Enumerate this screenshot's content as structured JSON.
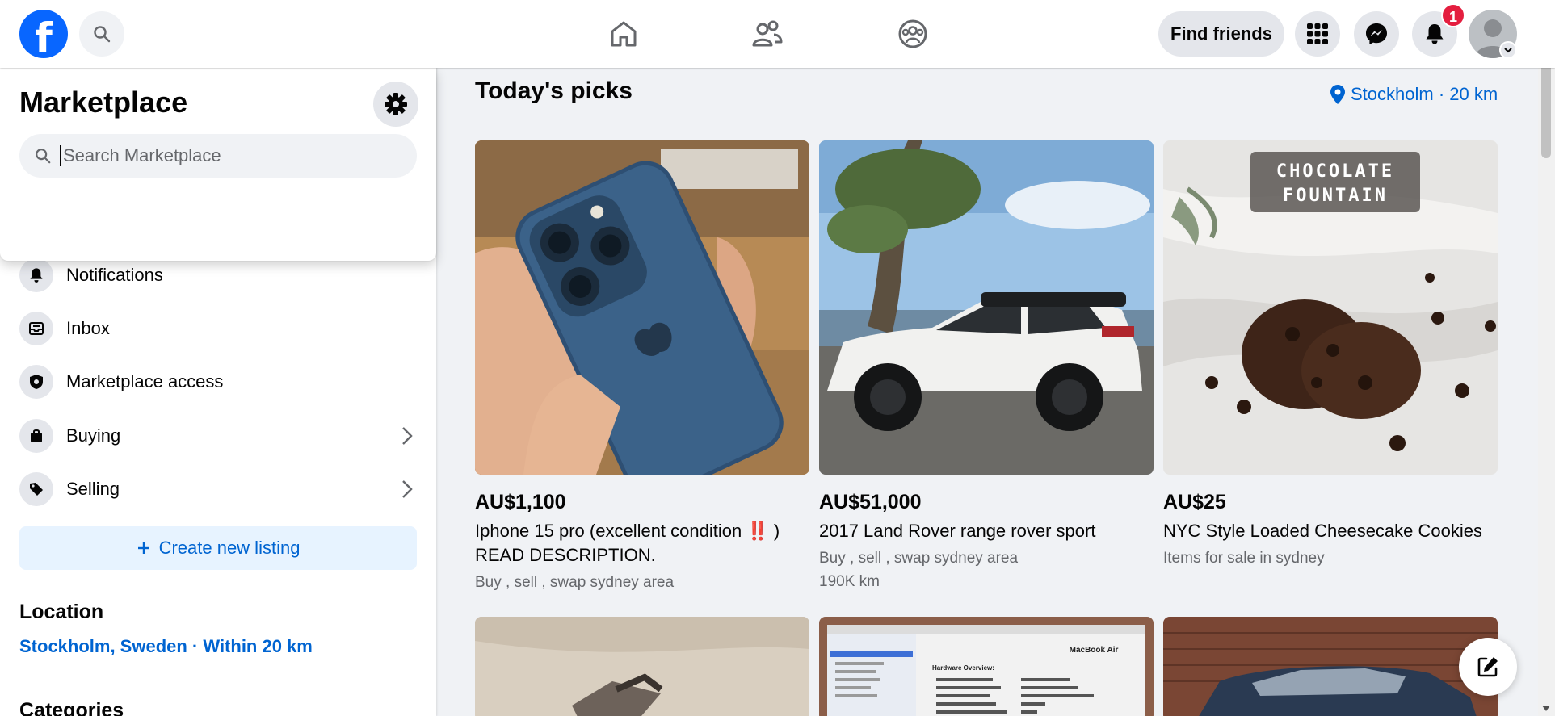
{
  "header": {
    "logo_letter": "f",
    "find_friends_label": "Find friends",
    "notification_count": "1",
    "icons": [
      "facebook-logo",
      "search-icon",
      "home-icon",
      "friends-icon",
      "groups-icon",
      "menu-grid-icon",
      "messenger-icon",
      "bell-icon",
      "avatar",
      "chevron-down-icon"
    ]
  },
  "popover": {
    "title": "Marketplace",
    "search_placeholder": "Search Marketplace"
  },
  "sidebar": {
    "items": [
      {
        "label": "Notifications",
        "icon": "bell-icon"
      },
      {
        "label": "Inbox",
        "icon": "inbox-icon"
      },
      {
        "label": "Marketplace access",
        "icon": "shield-icon"
      },
      {
        "label": "Buying",
        "icon": "shopping-bag-icon"
      },
      {
        "label": "Selling",
        "icon": "tag-icon"
      }
    ],
    "create_listing_label": "Create new listing",
    "location_heading": "Location",
    "location_value": "Stockholm, Sweden · Within 20 km",
    "categories_heading": "Categories"
  },
  "main": {
    "title": "Today's picks",
    "location_chip": "Stockholm · 20 km",
    "listings": [
      {
        "price": "AU$1,100",
        "title": "Iphone 15 pro (excellent condition ‼️ ) READ DESCRIPTION.",
        "meta": "Buy , sell , swap sydney area",
        "meta2": ""
      },
      {
        "price": "AU$51,000",
        "title": "2017 Land Rover range rover sport",
        "meta": "Buy , sell , swap sydney area",
        "meta2": "190K km"
      },
      {
        "price": "AU$25",
        "title": "NYC Style Loaded Cheesecake Cookies",
        "meta": "Items for sale in sydney",
        "meta2": ""
      }
    ],
    "cookie_overlay_text": "CHOCOLATE FOUNTAIN",
    "macbook_window_heading": "MacBook Air",
    "macbook_overview": "Hardware Overview:"
  },
  "colors": {
    "brand_blue": "#0866ff",
    "link_blue": "#0064d1",
    "badge_red": "#e41e3f",
    "background": "#f0f2f5"
  }
}
